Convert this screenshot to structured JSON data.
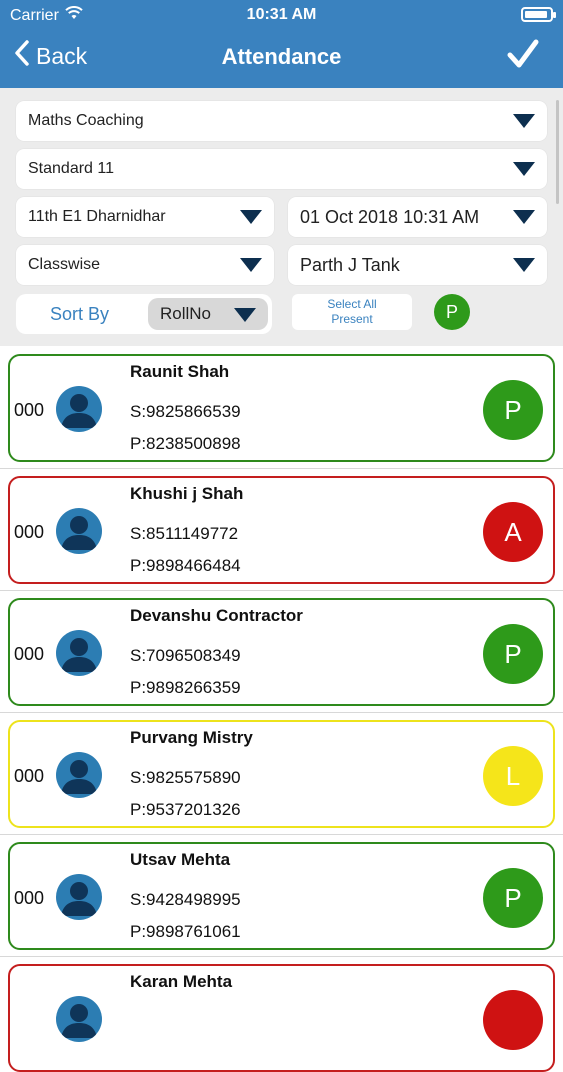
{
  "status_bar": {
    "carrier": "Carrier",
    "time": "10:31 AM"
  },
  "nav": {
    "back_label": "Back",
    "title": "Attendance"
  },
  "filters": {
    "course": "Maths Coaching",
    "standard": "Standard 11",
    "batch": "11th E1 Dharnidhar",
    "datetime": "01 Oct 2018 10:31 AM",
    "mode": "Classwise",
    "teacher": "Parth J Tank",
    "sort_label": "Sort By",
    "sort_value": "RollNo",
    "select_all_line1": "Select All",
    "select_all_line2": "Present",
    "select_all_status": "P"
  },
  "students": [
    {
      "roll": "000",
      "name": "Raunit Shah",
      "s_phone": "S:9825866539",
      "p_phone": "P:8238500898",
      "status": "P"
    },
    {
      "roll": "000",
      "name": "Khushi j Shah",
      "s_phone": "S:8511149772",
      "p_phone": "P:9898466484",
      "status": "A"
    },
    {
      "roll": "000",
      "name": "Devanshu Contractor",
      "s_phone": "S:7096508349",
      "p_phone": "P:9898266359",
      "status": "P"
    },
    {
      "roll": "000",
      "name": "Purvang Mistry",
      "s_phone": "S:9825575890",
      "p_phone": "P:9537201326",
      "status": "L"
    },
    {
      "roll": "000",
      "name": "Utsav Mehta",
      "s_phone": "S:9428498995",
      "p_phone": "P:9898761061",
      "status": "P"
    },
    {
      "roll": "",
      "name": "Karan Mehta",
      "s_phone": "",
      "p_phone": "",
      "status": ""
    }
  ],
  "colors": {
    "header": "#3a82bf",
    "present": "#2e9a1a",
    "absent": "#cf1212",
    "leave": "#f5e51a"
  }
}
